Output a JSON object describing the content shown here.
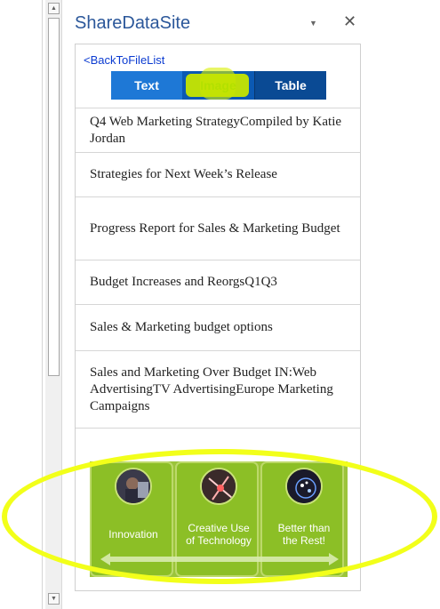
{
  "pane": {
    "title": "ShareDataSite"
  },
  "nav": {
    "back_label": "<BackToFileList"
  },
  "tabs": [
    {
      "label": "Text"
    },
    {
      "label": "Image"
    },
    {
      "label": "Table"
    }
  ],
  "documents": [
    "Q4 Web Marketing StrategyCompiled by Katie Jordan",
    "Strategies for Next Week’s Release",
    "Progress Report for Sales & Marketing Budget",
    "Budget Increases and ReorgsQ1Q3",
    "Sales & Marketing budget options",
    "Sales and Marketing Over Budget IN:Web AdvertisingTV AdvertisingEurope Marketing Campaigns"
  ],
  "smartart": {
    "cards": [
      {
        "line1": "Innovation",
        "line2": ""
      },
      {
        "line1": "Creative Use",
        "line2": "of Technology"
      },
      {
        "line1": "Better than",
        "line2": "the Rest!"
      }
    ]
  },
  "colors": {
    "title": "#2b579a",
    "tab_text": "#1e78d6",
    "tab_image": "#0b59b3",
    "tab_table": "#0a4a94",
    "smartart_green": "#8cbf26",
    "annotation_yellow": "#f2ff1a"
  }
}
